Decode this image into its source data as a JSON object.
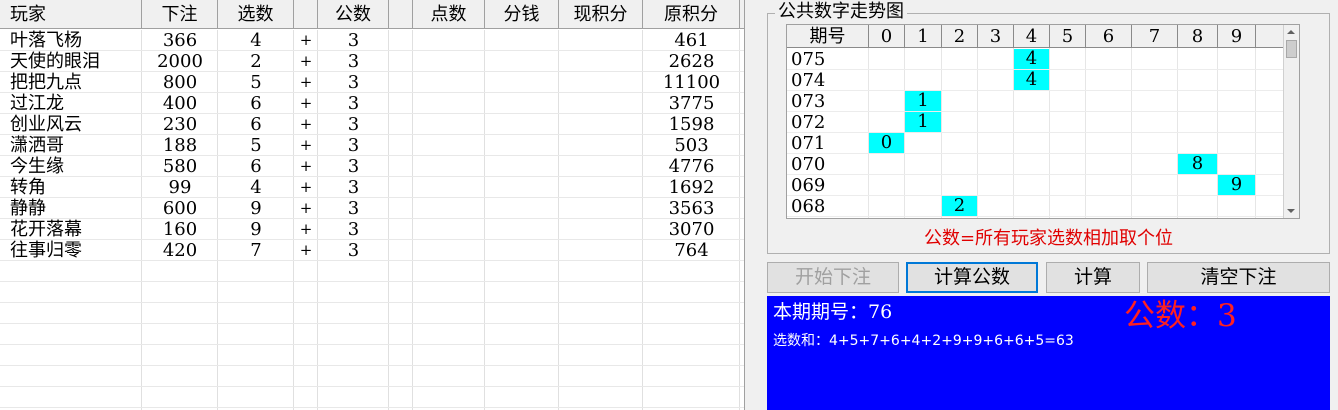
{
  "players": {
    "columns": [
      "玩家",
      "下注",
      "选数",
      "",
      "公数",
      "",
      "点数",
      "分钱",
      "现积分",
      "原积分"
    ],
    "rows": [
      {
        "name": "叶落飞杨",
        "bet": "366",
        "pick": "4",
        "op": "+",
        "public": "3",
        "points": "",
        "share": "",
        "current": "",
        "original": "461"
      },
      {
        "name": "天使的眼泪",
        "bet": "2000",
        "pick": "2",
        "op": "+",
        "public": "3",
        "points": "",
        "share": "",
        "current": "",
        "original": "2628"
      },
      {
        "name": "把把九点",
        "bet": "800",
        "pick": "5",
        "op": "+",
        "public": "3",
        "points": "",
        "share": "",
        "current": "",
        "original": "11100"
      },
      {
        "name": "过江龙",
        "bet": "400",
        "pick": "6",
        "op": "+",
        "public": "3",
        "points": "",
        "share": "",
        "current": "",
        "original": "3775"
      },
      {
        "name": "创业风云",
        "bet": "230",
        "pick": "6",
        "op": "+",
        "public": "3",
        "points": "",
        "share": "",
        "current": "",
        "original": "1598"
      },
      {
        "name": "潇洒哥",
        "bet": "188",
        "pick": "5",
        "op": "+",
        "public": "3",
        "points": "",
        "share": "",
        "current": "",
        "original": "503"
      },
      {
        "name": "今生缘",
        "bet": "580",
        "pick": "6",
        "op": "+",
        "public": "3",
        "points": "",
        "share": "",
        "current": "",
        "original": "4776"
      },
      {
        "name": "转角",
        "bet": "99",
        "pick": "4",
        "op": "+",
        "public": "3",
        "points": "",
        "share": "",
        "current": "",
        "original": "1692"
      },
      {
        "name": "静静",
        "bet": "600",
        "pick": "9",
        "op": "+",
        "public": "3",
        "points": "",
        "share": "",
        "current": "",
        "original": "3563"
      },
      {
        "name": "花开落幕",
        "bet": "160",
        "pick": "9",
        "op": "+",
        "public": "3",
        "points": "",
        "share": "",
        "current": "",
        "original": "3070"
      },
      {
        "name": "往事归零",
        "bet": "420",
        "pick": "7",
        "op": "+",
        "public": "3",
        "points": "",
        "share": "",
        "current": "",
        "original": "764"
      }
    ]
  },
  "trend": {
    "title": "公共数字走势图",
    "period_header": "期号",
    "digits": [
      "0",
      "1",
      "2",
      "3",
      "4",
      "5",
      "6",
      "7",
      "8",
      "9"
    ],
    "rows": [
      {
        "period": "075",
        "value": "4"
      },
      {
        "period": "074",
        "value": "4"
      },
      {
        "period": "073",
        "value": "1"
      },
      {
        "period": "072",
        "value": "1"
      },
      {
        "period": "071",
        "value": "0"
      },
      {
        "period": "070",
        "value": "8"
      },
      {
        "period": "069",
        "value": "9"
      },
      {
        "period": "068",
        "value": "2"
      }
    ],
    "hit_color": "#00ffff",
    "rule_note": "公数=所有玩家选数相加取个位"
  },
  "buttons": {
    "start": "开始下注",
    "calc_public": "计算公数",
    "calc": "计算",
    "clear": "清空下注"
  },
  "info": {
    "period_label": "本期期号：76",
    "public_label": "公数：3",
    "sum_line": "选数和：4+5+7+6+4+2+9+9+6+6+5=63",
    "background": "#0000ff",
    "accent": "#ff2020"
  }
}
